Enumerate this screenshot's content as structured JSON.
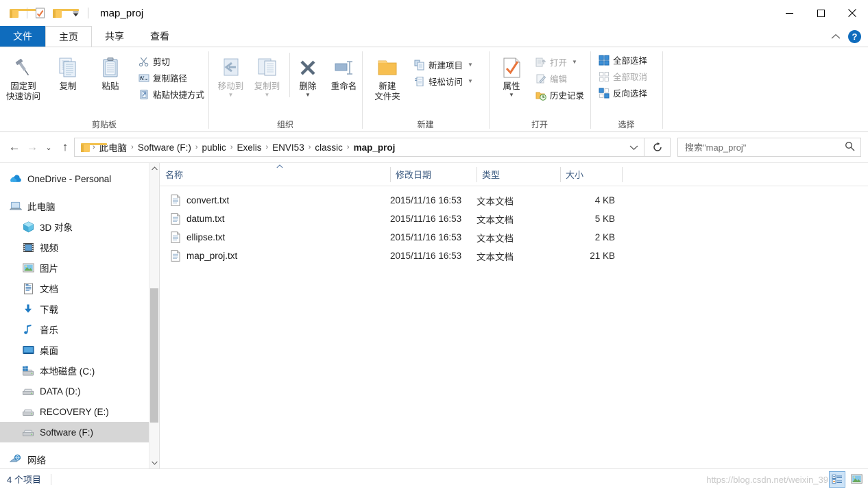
{
  "window": {
    "title": "map_proj",
    "minimize_label": "–",
    "maximize_label": "□",
    "close_label": "✕"
  },
  "quick_access": {
    "items": [
      {
        "name": "folder-icon",
        "label": ""
      },
      {
        "name": "properties-icon",
        "label": ""
      },
      {
        "name": "new-folder-icon",
        "label": ""
      },
      {
        "name": "customize-dropdown-icon",
        "label": "▼"
      }
    ]
  },
  "tabs": [
    {
      "label": "文件",
      "state": "file"
    },
    {
      "label": "主页",
      "state": "active"
    },
    {
      "label": "共享",
      "state": "normal"
    },
    {
      "label": "查看",
      "state": "normal"
    }
  ],
  "tab_right": {
    "collapse_label": "⌃",
    "help_label": "?"
  },
  "ribbon": {
    "groups": [
      {
        "label": "剪贴板",
        "big": [
          {
            "label1": "固定到",
            "label2": "快速访问",
            "icon": "pin-icon"
          },
          {
            "label1": "复制",
            "label2": "",
            "icon": "copy-icon"
          },
          {
            "label1": "粘贴",
            "label2": "",
            "icon": "paste-icon"
          }
        ],
        "small": [
          {
            "label": "剪切",
            "icon": "scissors-icon",
            "dim": false
          },
          {
            "label": "复制路径",
            "icon": "copy-path-icon",
            "dim": false
          },
          {
            "label": "粘贴快捷方式",
            "icon": "paste-shortcut-icon",
            "dim": false
          }
        ]
      },
      {
        "label": "组织",
        "big": [
          {
            "label1": "移动到",
            "label2": "",
            "icon": "move-to-icon",
            "caret": true,
            "dim": true
          },
          {
            "label1": "复制到",
            "label2": "",
            "icon": "copy-to-icon",
            "caret": true,
            "dim": true
          },
          {
            "label1": "删除",
            "label2": "",
            "icon": "delete-icon",
            "caret": true
          },
          {
            "label1": "重命名",
            "label2": "",
            "icon": "rename-icon"
          }
        ],
        "small": []
      },
      {
        "label": "新建",
        "big": [
          {
            "label1": "新建",
            "label2": "文件夹",
            "icon": "new-folder-large-icon"
          }
        ],
        "small": [
          {
            "label": "新建项目",
            "icon": "new-item-icon",
            "caret": true
          },
          {
            "label": "轻松访问",
            "icon": "easy-access-icon",
            "caret": true
          }
        ]
      },
      {
        "label": "打开",
        "big": [
          {
            "label1": "属性",
            "label2": "",
            "icon": "properties-large-icon",
            "caret": true
          }
        ],
        "small": [
          {
            "label": "打开",
            "icon": "open-icon",
            "caret": true,
            "dim": true
          },
          {
            "label": "编辑",
            "icon": "edit-icon",
            "dim": true
          },
          {
            "label": "历史记录",
            "icon": "history-icon",
            "dim": false
          }
        ]
      },
      {
        "label": "选择",
        "big": [],
        "small": [
          {
            "label": "全部选择",
            "icon": "select-all-icon"
          },
          {
            "label": "全部取消",
            "icon": "select-none-icon",
            "dim": true
          },
          {
            "label": "反向选择",
            "icon": "invert-selection-icon"
          }
        ]
      }
    ]
  },
  "address": {
    "back_label": "←",
    "forward_label": "→",
    "recent_label": "⌄",
    "up_label": "↑",
    "dropdown_label": "⌄",
    "refresh_label": "↻",
    "breadcrumbs": [
      "此电脑",
      "Software (F:)",
      "public",
      "Exelis",
      "ENVI53",
      "classic",
      "map_proj"
    ],
    "separator": "›"
  },
  "search": {
    "value": "",
    "placeholder": "搜索\"map_proj\"",
    "icon": "search-icon"
  },
  "sidebar": {
    "items": [
      {
        "label": "OneDrive - Personal",
        "icon": "onedrive-icon",
        "level": "root",
        "selected": false
      },
      {
        "label": "此电脑",
        "icon": "this-pc-icon",
        "level": "root",
        "selected": false
      },
      {
        "label": "3D 对象",
        "icon": "3d-objects-icon",
        "level": "indent",
        "selected": false
      },
      {
        "label": "视频",
        "icon": "videos-icon",
        "level": "indent",
        "selected": false
      },
      {
        "label": "图片",
        "icon": "pictures-icon",
        "level": "indent",
        "selected": false
      },
      {
        "label": "文档",
        "icon": "documents-icon",
        "level": "indent",
        "selected": false
      },
      {
        "label": "下载",
        "icon": "downloads-icon",
        "level": "indent",
        "selected": false
      },
      {
        "label": "音乐",
        "icon": "music-icon",
        "level": "indent",
        "selected": false
      },
      {
        "label": "桌面",
        "icon": "desktop-icon",
        "level": "indent",
        "selected": false
      },
      {
        "label": "本地磁盘 (C:)",
        "icon": "windows-drive-icon",
        "level": "indent",
        "selected": false
      },
      {
        "label": "DATA (D:)",
        "icon": "drive-icon",
        "level": "indent",
        "selected": false
      },
      {
        "label": "RECOVERY (E:)",
        "icon": "drive-icon",
        "level": "indent",
        "selected": false
      },
      {
        "label": "Software (F:)",
        "icon": "drive-icon",
        "level": "indent",
        "selected": true
      },
      {
        "label": "网络",
        "icon": "network-icon",
        "level": "root",
        "selected": false
      }
    ],
    "scroll_up": "⌃",
    "scroll_down": "⌄"
  },
  "file_list": {
    "columns": [
      {
        "label": "名称",
        "sorted": "asc"
      },
      {
        "label": "修改日期",
        "sorted": ""
      },
      {
        "label": "类型",
        "sorted": ""
      },
      {
        "label": "大小",
        "sorted": ""
      }
    ],
    "sort_indicator": "⌃",
    "rows": [
      {
        "name": "convert.txt",
        "date": "2015/11/16 16:53",
        "type": "文本文档",
        "size": "4 KB",
        "icon": "text-file-icon"
      },
      {
        "name": "datum.txt",
        "date": "2015/11/16 16:53",
        "type": "文本文档",
        "size": "5 KB",
        "icon": "text-file-icon"
      },
      {
        "name": "ellipse.txt",
        "date": "2015/11/16 16:53",
        "type": "文本文档",
        "size": "2 KB",
        "icon": "text-file-icon"
      },
      {
        "name": "map_proj.txt",
        "date": "2015/11/16 16:53",
        "type": "文本文档",
        "size": "21 KB",
        "icon": "text-file-icon"
      }
    ]
  },
  "status_bar": {
    "item_count": "4 个项目",
    "watermark": "https://blog.csdn.net/weixin_39",
    "views": [
      {
        "name": "details-view-button",
        "active": true
      },
      {
        "name": "large-icons-view-button",
        "active": false
      }
    ]
  },
  "colors": {
    "accent": "#0f6cbd",
    "selection": "#d6d6d6",
    "hover": "#e8f1fb",
    "folder_yellow": "#fbc85b",
    "column_header_text": "#3b5a80",
    "status_text": "#1f3b63"
  }
}
